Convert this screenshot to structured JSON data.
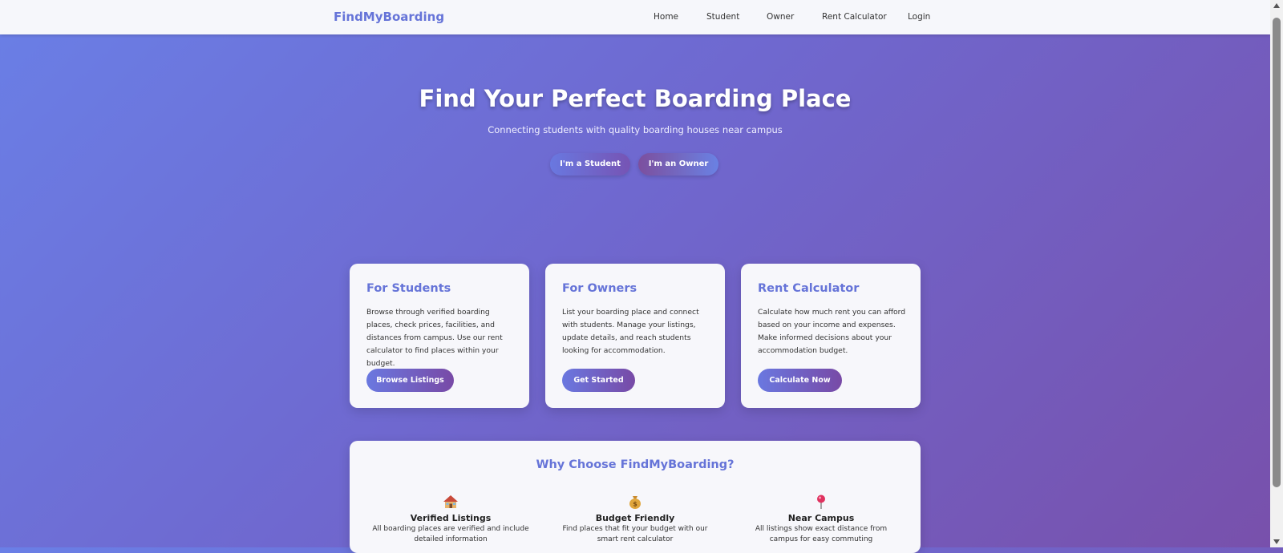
{
  "nav": {
    "brand": "FindMyBoarding",
    "links": [
      "Home",
      "Student",
      "Owner",
      "Rent Calculator",
      "Login"
    ]
  },
  "hero": {
    "title": "Find Your Perfect Boarding Place",
    "subtitle": "Connecting students with quality boarding houses near campus",
    "student_button": "I'm a Student",
    "owner_button": "I'm an Owner"
  },
  "cards": [
    {
      "title": "For Students",
      "text": "Browse through verified boarding places, check prices, facilities, and distances from campus. Use our rent calculator to find places within your budget.",
      "button": "Browse Listings"
    },
    {
      "title": "For Owners",
      "text": "List your boarding place and connect with students. Manage your listings, update details, and reach students looking for accommodation.",
      "button": "Get Started"
    },
    {
      "title": "Rent Calculator",
      "text": "Calculate how much rent you can afford based on your income and expenses. Make informed decisions about your accommodation budget.",
      "button": "Calculate Now"
    }
  ],
  "why": {
    "title": "Why Choose FindMyBoarding?",
    "features": [
      {
        "icon": "house-icon",
        "name": "Verified Listings",
        "desc": "All boarding places are verified and include detailed information"
      },
      {
        "icon": "money-bag-icon",
        "name": "Budget Friendly",
        "desc": "Find places that fit your budget with our smart rent calculator"
      },
      {
        "icon": "pin-icon",
        "name": "Near Campus",
        "desc": "All listings show exact distance from campus for easy commuting"
      }
    ]
  },
  "colors": {
    "accent": "#6674d8",
    "gradient_start": "#6a7fe6",
    "gradient_end": "#7850ab"
  }
}
